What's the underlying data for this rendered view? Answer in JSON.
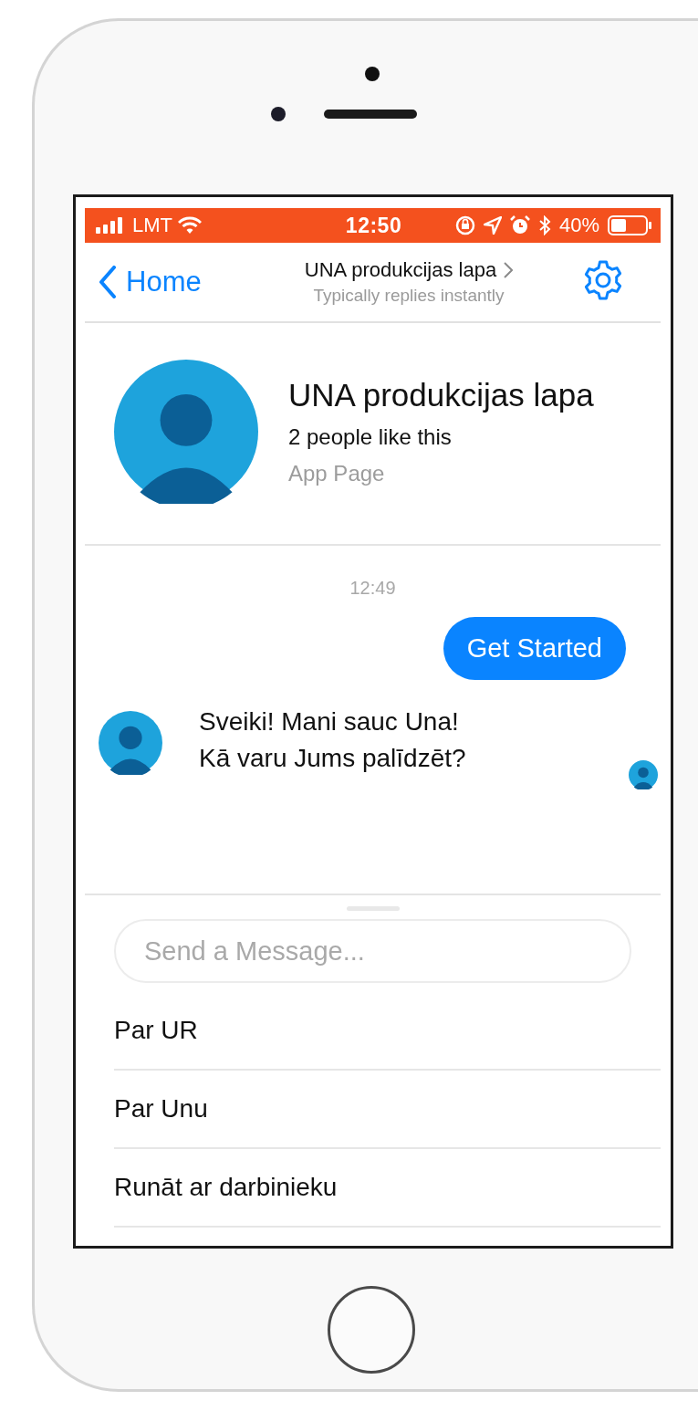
{
  "status_bar": {
    "carrier": "LMT",
    "time": "12:50",
    "battery": "40%"
  },
  "nav": {
    "back": "Home",
    "title": "UNA produkcijas lapa",
    "subtitle": "Typically replies instantly"
  },
  "page": {
    "name": "UNA produkcijas lapa",
    "likes": "2 people like this",
    "category": "App Page"
  },
  "thread": {
    "timestamp": "12:49",
    "messages": [
      {
        "kind": "outgoing",
        "text": "Get Started"
      },
      {
        "kind": "incoming",
        "text": "Sveiki! Mani sauc Una!\nKā varu Jums palīdzēt?"
      }
    ]
  },
  "composer": {
    "placeholder": "Send a Message..."
  },
  "quick_replies": [
    "Par UR",
    "Par Unu",
    "Runāt ar darbinieku"
  ]
}
